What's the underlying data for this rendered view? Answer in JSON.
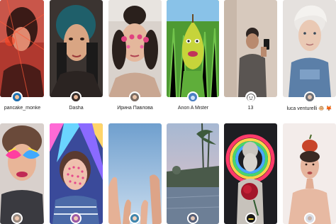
{
  "effects": [
    {
      "creator": "pancake_monke"
    },
    {
      "creator": "Dasha"
    },
    {
      "creator": "Ирина Павлова"
    },
    {
      "creator": "Anon A Mister"
    },
    {
      "creator": "13"
    },
    {
      "creator": "luca venturelli 🐵 🦊"
    }
  ],
  "colors": {
    "background": "#ffffff",
    "text": "#222222"
  }
}
